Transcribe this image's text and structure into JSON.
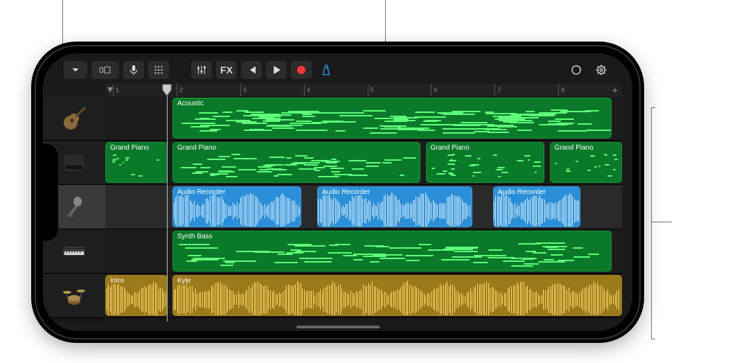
{
  "toolbar": {
    "fx_label": "FX"
  },
  "ruler": {
    "bars": [
      "1",
      "2",
      "3",
      "4",
      "5",
      "6",
      "7",
      "8"
    ]
  },
  "playhead": {
    "position_pct": 12
  },
  "tracks": [
    {
      "icon": "guitar",
      "selected": false,
      "regions": [
        {
          "label": "Acoustic",
          "type": "midi",
          "color": "green",
          "start_pct": 13,
          "width_pct": 85
        }
      ]
    },
    {
      "icon": "piano",
      "selected": false,
      "regions": [
        {
          "label": "Grand Piano",
          "type": "midi",
          "color": "green",
          "start_pct": 0,
          "width_pct": 12
        },
        {
          "label": "Grand Piano",
          "type": "midi",
          "color": "green",
          "start_pct": 13,
          "width_pct": 48
        },
        {
          "label": "Grand Piano",
          "type": "midi",
          "color": "green",
          "start_pct": 62,
          "width_pct": 23
        },
        {
          "label": "Grand Piano",
          "type": "midi",
          "color": "green",
          "start_pct": 86,
          "width_pct": 14
        }
      ]
    },
    {
      "icon": "microphone",
      "selected": true,
      "regions": [
        {
          "label": "Audio Recorder",
          "type": "audio",
          "color": "blue",
          "start_pct": 13,
          "width_pct": 25
        },
        {
          "label": "Audio Recorder",
          "type": "audio",
          "color": "blue",
          "start_pct": 41,
          "width_pct": 30
        },
        {
          "label": "Audio Recorder",
          "type": "audio",
          "color": "blue",
          "start_pct": 75,
          "width_pct": 17
        }
      ]
    },
    {
      "icon": "keyboard",
      "selected": false,
      "regions": [
        {
          "label": "Synth Bass",
          "type": "midi",
          "color": "green",
          "start_pct": 13,
          "width_pct": 85
        }
      ]
    },
    {
      "icon": "drums",
      "selected": false,
      "regions": [
        {
          "label": "Intro",
          "type": "audio",
          "color": "yellow",
          "start_pct": 0,
          "width_pct": 12
        },
        {
          "label": "Kyle",
          "type": "audio",
          "color": "yellow",
          "start_pct": 13,
          "width_pct": 87
        }
      ]
    }
  ],
  "add_button": "+"
}
